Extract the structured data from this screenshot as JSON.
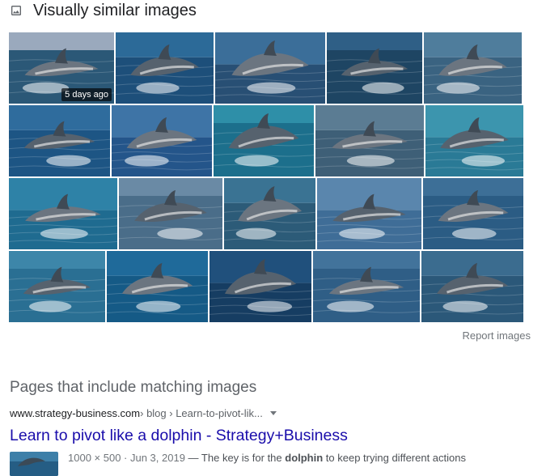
{
  "section": {
    "icon": "image-icon",
    "title": "Visually similar images"
  },
  "images": {
    "rows": [
      [
        {
          "name": "dolphin-image-1",
          "badge": "5 days ago",
          "sky": "#9aa9bd",
          "sea": "#2b5877"
        },
        {
          "name": "dolphin-image-2",
          "sky": "#2c6a98",
          "sea": "#1d4f7a"
        },
        {
          "name": "dolphin-image-3",
          "sky": "#3b6e99",
          "sea": "#284f74"
        },
        {
          "name": "dolphin-image-4",
          "sky": "#2f5f86",
          "sea": "#1e4563"
        },
        {
          "name": "dolphin-image-5",
          "sky": "#4f7d9c",
          "sea": "#3a6381"
        }
      ],
      [
        {
          "name": "dolphin-image-6",
          "sky": "#2f6c9d",
          "sea": "#1d5584"
        },
        {
          "name": "dolphin-image-7",
          "sky": "#3e74a6",
          "sea": "#24558a"
        },
        {
          "name": "dolphin-image-8",
          "sky": "#2e8fa8",
          "sea": "#1c6f8c"
        },
        {
          "name": "dolphin-image-9",
          "sky": "#5b7c93",
          "sea": "#3e5f77"
        },
        {
          "name": "dolphin-image-10",
          "sky": "#3c95ae",
          "sea": "#2a7a96"
        }
      ],
      [
        {
          "name": "dolphin-image-11",
          "sky": "#2e82a7",
          "sea": "#1f6b90"
        },
        {
          "name": "dolphin-image-12",
          "sky": "#6a8aa5",
          "sea": "#4a6d89"
        },
        {
          "name": "dolphin-image-13",
          "sky": "#3a7393",
          "sea": "#2c5b78"
        },
        {
          "name": "dolphin-image-14",
          "sky": "#5a86ad",
          "sea": "#3f6d97"
        },
        {
          "name": "dolphin-image-15",
          "sky": "#3d6f97",
          "sea": "#2b5c84"
        }
      ],
      [
        {
          "name": "dolphin-image-16",
          "sky": "#3d86a9",
          "sea": "#2a6f93"
        },
        {
          "name": "dolphin-image-17",
          "sky": "#1f6a9a",
          "sea": "#155a86"
        },
        {
          "name": "dolphin-image-18",
          "sky": "#20507c",
          "sea": "#163d62"
        },
        {
          "name": "dolphin-image-19",
          "sky": "#42739b",
          "sea": "#2f5e86"
        },
        {
          "name": "dolphin-image-20",
          "sky": "#3b6c8f",
          "sea": "#2b5879"
        }
      ]
    ]
  },
  "report_link": "Report images",
  "pages_section": {
    "title": "Pages that include matching images",
    "result": {
      "domain": "www.strategy-business.com",
      "path": " › blog › Learn-to-pivot-lik...",
      "title": "Learn to pivot like a dolphin - Strategy+Business",
      "meta": "1000 × 500 · Jun 3, 2019",
      "snippet_pre": " — The key is for the ",
      "snippet_bold": "dolphin",
      "snippet_post": " to keep trying different actions"
    }
  }
}
